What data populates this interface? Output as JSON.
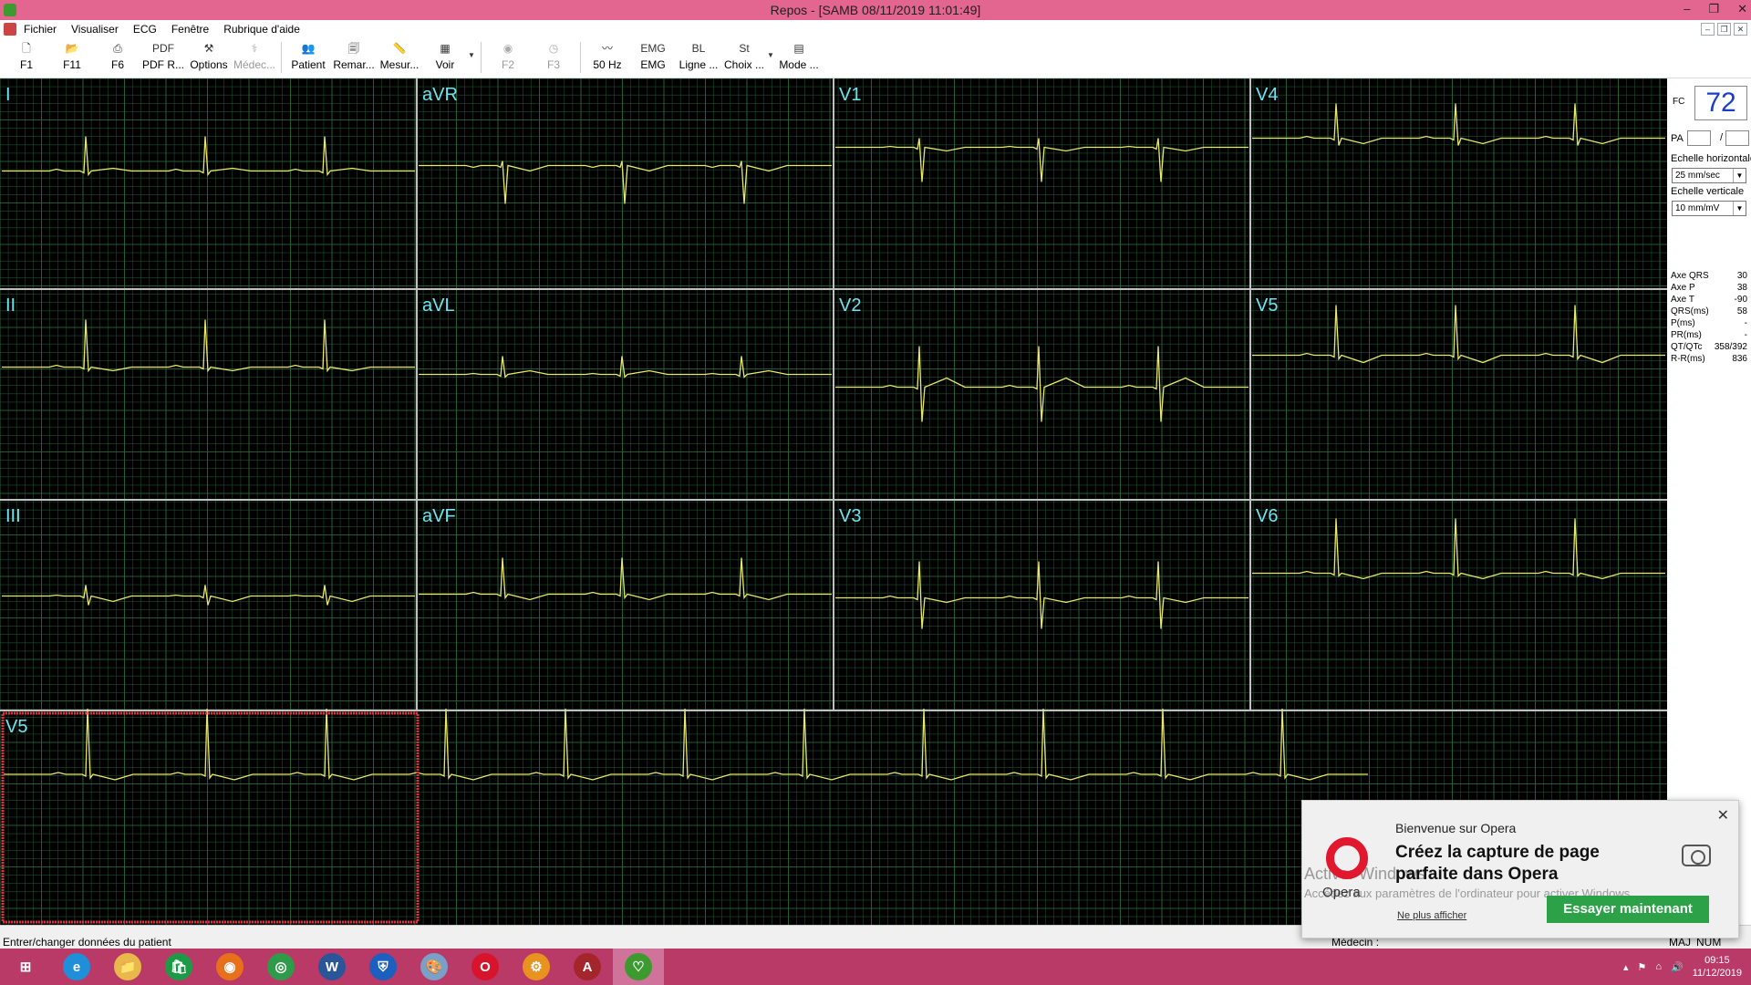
{
  "window": {
    "title": "Repos - [SAMB  08/11/2019 11:01:49]",
    "min": "–",
    "restore": "❐",
    "close": "✕"
  },
  "menu": [
    "Fichier",
    "Visualiser",
    "ECG",
    "Fenêtre",
    "Rubrique d'aide"
  ],
  "mdi": {
    "min": "–",
    "restore": "❐",
    "close": "✕"
  },
  "toolbar": [
    {
      "label": "F1",
      "icon": "new-file-icon",
      "glyph": "🗋",
      "enabled": true
    },
    {
      "label": "F11",
      "icon": "open-folder-icon",
      "glyph": "📂",
      "enabled": true
    },
    {
      "label": "F6",
      "icon": "printer-icon",
      "glyph": "⎙",
      "enabled": true
    },
    {
      "label": "PDF R...",
      "icon": "pdf-icon",
      "glyph": "PDF",
      "enabled": true
    },
    {
      "label": "Options",
      "icon": "wrench-icon",
      "glyph": "⚒",
      "enabled": true
    },
    {
      "label": "Médec...",
      "icon": "doctor-icon",
      "glyph": "⚕",
      "enabled": false
    },
    {
      "label": "Patient",
      "icon": "patient-icon",
      "glyph": "👥",
      "enabled": true
    },
    {
      "label": "Remar...",
      "icon": "remark-icon",
      "glyph": "🗐",
      "enabled": true
    },
    {
      "label": "Mesur...",
      "icon": "ruler-icon",
      "glyph": "📏",
      "enabled": true
    },
    {
      "label": "Voir",
      "icon": "grid-view-icon",
      "glyph": "▦",
      "enabled": true
    },
    {
      "label": "F2",
      "icon": "f2-icon",
      "glyph": "◉",
      "enabled": false
    },
    {
      "label": "F3",
      "icon": "f3-icon",
      "glyph": "◷",
      "enabled": false
    },
    {
      "label": "50 Hz",
      "icon": "filter-50hz-icon",
      "glyph": "〰",
      "enabled": true
    },
    {
      "label": "EMG",
      "icon": "emg-icon",
      "glyph": "EMG",
      "enabled": true
    },
    {
      "label": "Ligne ...",
      "icon": "baseline-icon",
      "glyph": "BL",
      "enabled": true
    },
    {
      "label": "Choix ...",
      "icon": "st-choice-icon",
      "glyph": "St",
      "enabled": true
    },
    {
      "label": "Mode ...",
      "icon": "mode-icon",
      "glyph": "▤",
      "enabled": true
    }
  ],
  "ecg": {
    "leads": [
      "I",
      "aVR",
      "V1",
      "V4",
      "II",
      "aVL",
      "V2",
      "V5",
      "III",
      "aVF",
      "V3",
      "V6"
    ],
    "rhythm_lead": "V5",
    "colors": {
      "grid": "#1f4b2c",
      "grid_major": "#2e6a3e",
      "trace": "#e8e86a",
      "label": "#6ee4f0",
      "selection": "#e0303a"
    }
  },
  "side": {
    "fc_label": "FC",
    "fc_value": "72",
    "pa_label": "PA",
    "pa_sep": "/",
    "h_scale_label": "Echelle horizontale",
    "h_scale_value": "25 mm/sec",
    "v_scale_label": "Echelle verticale",
    "v_scale_value": "10 mm/mV",
    "measurements": [
      {
        "label": "Axe QRS",
        "value": "30"
      },
      {
        "label": "Axe P",
        "value": "38"
      },
      {
        "label": "Axe T",
        "value": "-90"
      },
      {
        "label": "QRS(ms)",
        "value": "58"
      },
      {
        "label": "P(ms)",
        "value": "-"
      },
      {
        "label": "PR(ms)",
        "value": "-"
      },
      {
        "label": "QT/QTc",
        "value": "358/392"
      },
      {
        "label": "R-R(ms)",
        "value": "836"
      }
    ]
  },
  "status": {
    "left": "Entrer/changer données du patient",
    "medecin": "Médecin :",
    "maj": "MAJ",
    "num": "NUM"
  },
  "opera": {
    "welcome": "Bienvenue sur Opera",
    "headline": "Créez la capture de page parfaite dans Opera",
    "logo_text": "Opera",
    "watermark1": "Activer Windows",
    "watermark2": "Accédez aux paramètres de l'ordinateur pour activer Windows.",
    "never": "Ne plus afficher",
    "try": "Essayer maintenant",
    "close": "✕"
  },
  "taskbar": [
    {
      "name": "start-icon",
      "glyph": "⊞",
      "color": "#b93a66"
    },
    {
      "name": "ie-icon",
      "glyph": "e",
      "color": "#1e8fd8"
    },
    {
      "name": "file-explorer-icon",
      "glyph": "📁",
      "color": "#e8b84a"
    },
    {
      "name": "store-icon",
      "glyph": "🛍",
      "color": "#1d9a46"
    },
    {
      "name": "firefox-icon",
      "glyph": "◉",
      "color": "#e8701a"
    },
    {
      "name": "chrome-icon",
      "glyph": "◎",
      "color": "#2e9b4a"
    },
    {
      "name": "word-icon",
      "glyph": "W",
      "color": "#2a5699"
    },
    {
      "name": "defender-icon",
      "glyph": "⛨",
      "color": "#1d5fbf"
    },
    {
      "name": "paint-icon",
      "glyph": "🎨",
      "color": "#7aa0c8"
    },
    {
      "name": "opera-icon",
      "glyph": "O",
      "color": "#d8142c"
    },
    {
      "name": "settings-gear-icon",
      "glyph": "⚙",
      "color": "#e89220"
    },
    {
      "name": "access-icon",
      "glyph": "A",
      "color": "#a4262c"
    },
    {
      "name": "ecg-app-icon",
      "glyph": "♡",
      "color": "#3c9a2f"
    }
  ],
  "tray": {
    "time": "09:15",
    "date": "11/12/2019"
  }
}
